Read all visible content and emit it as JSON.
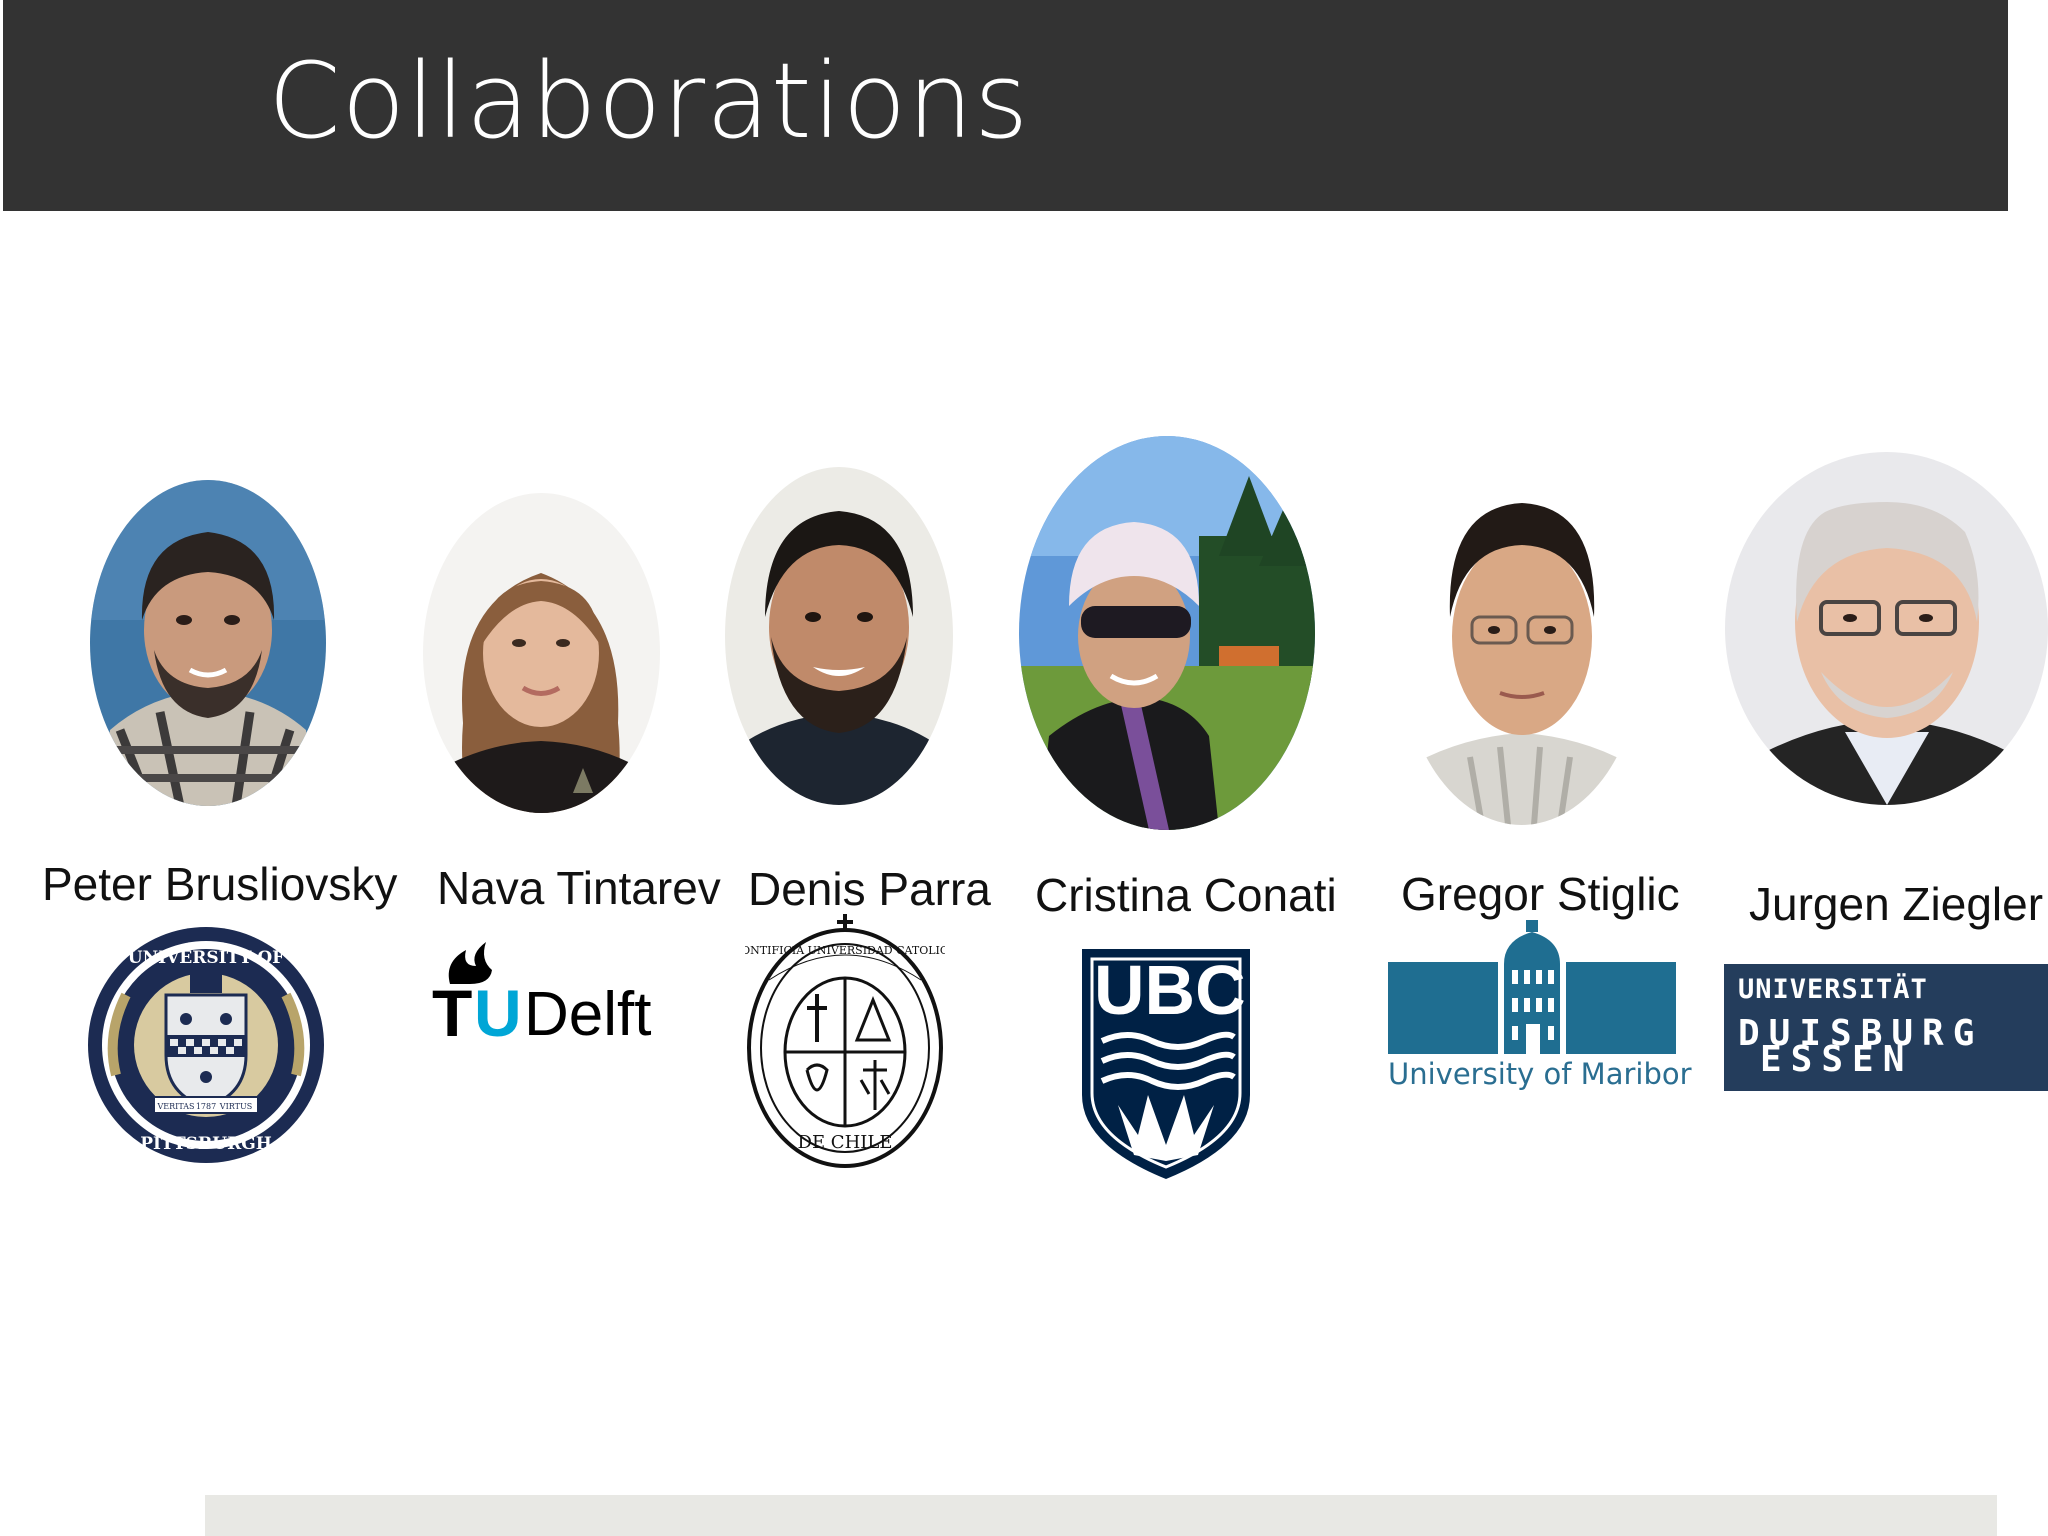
{
  "slide": {
    "title": "Collaborations"
  },
  "collaborators": [
    {
      "name": "Peter Brusliovsky",
      "photo_icon": "portrait-photo",
      "logo_icon": "university-of-pittsburgh-seal"
    },
    {
      "name": "Nava Tintarev",
      "photo_icon": "portrait-photo",
      "logo_icon": "tu-delft-logo"
    },
    {
      "name": "Denis Parra",
      "photo_icon": "portrait-photo",
      "logo_icon": "puc-chile-seal"
    },
    {
      "name": "Cristina Conati",
      "photo_icon": "portrait-photo",
      "logo_icon": "ubc-crest"
    },
    {
      "name": "Gregor Stiglic",
      "photo_icon": "portrait-photo",
      "logo_icon": "university-of-maribor-logo"
    },
    {
      "name": "Jurgen Ziegler",
      "photo_icon": "portrait-photo",
      "logo_icon": "universitat-duisburg-essen-logo"
    }
  ],
  "logos": {
    "pitt": {
      "top_arc": "UNIVERSITY OF",
      "bottom_arc": "PITTSBURGH",
      "motto_left": "VERITAS",
      "year": "1787",
      "motto_right": "VIRTUS"
    },
    "tudelft": {
      "t": "T",
      "u": "U",
      "delft": "Delft"
    },
    "puc": {
      "arc_text": "PONTIFICIA UNIVERSIDAD CATOLICA",
      "bottom_text": "DE CHILE"
    },
    "ubc": {
      "text": "UBC"
    },
    "maribor": {
      "caption": "University of Maribor"
    },
    "ude": {
      "line1": "UNIVERSITÄT",
      "line2": "DUISBURG",
      "line3": "ESSEN"
    }
  },
  "colors": {
    "header_bg": "#333333",
    "title_text": "#ffffff",
    "tudelft_blue": "#00a6d6",
    "ubc_navy": "#002145",
    "maribor_teal": "#1f6e91",
    "ude_navy": "#243d5c",
    "pitt_gold": "#b8a46a",
    "pitt_navy": "#1c2b52"
  }
}
